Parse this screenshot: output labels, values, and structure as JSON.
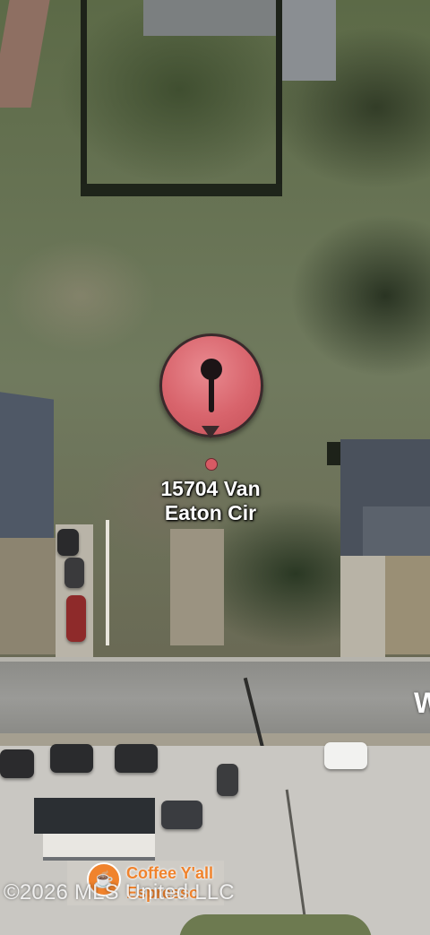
{
  "map": {
    "type": "satellite",
    "marker": {
      "icon": "pin-icon",
      "color": "#d8646c",
      "address_line1": "15704 Van",
      "address_line2": "Eaton Cir"
    },
    "street_label": "W",
    "poi": {
      "icon": "coffee-cup-icon",
      "color": "#f0832d",
      "name_line1": "Coffee Y'all",
      "name_line2": "Espresso"
    },
    "copyright": "©2026 MLS United LLC"
  }
}
